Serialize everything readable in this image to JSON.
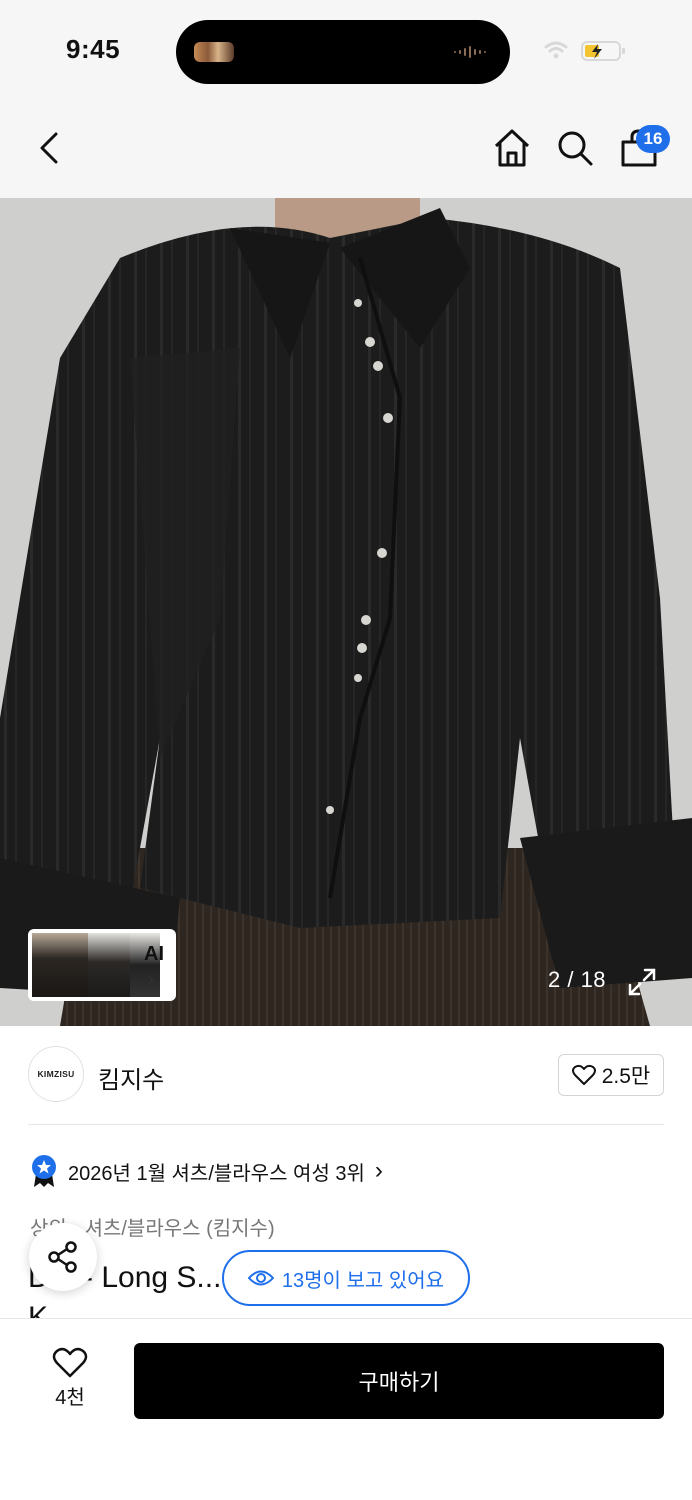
{
  "status_bar": {
    "time": "9:45"
  },
  "header": {
    "cart_count": "16"
  },
  "gallery": {
    "ai_label": "AI",
    "page_indicator": "2 / 18",
    "thumbnail_count": 3
  },
  "brand": {
    "logo_text": "KIMZISU",
    "name": "킴지수",
    "likes": "2.5만"
  },
  "ranking": {
    "text": "2026년 1월 셔츠/블라우스 여성 3위",
    "chevron": "›"
  },
  "breadcrumb": "상의 › 셔츠/블라우스 (킴지수)",
  "product": {
    "title_line1": "D... - Long S... Shirt _ BLAC",
    "title_line2": "K"
  },
  "viewers_pill": {
    "text": "13명이 보고 있어요"
  },
  "bottom": {
    "wishlist_count": "4천",
    "buy_label": "구매하기"
  },
  "colors": {
    "accent": "#1f6feb",
    "buy_button": "#000000",
    "header_bg": "#f6f6f6"
  }
}
